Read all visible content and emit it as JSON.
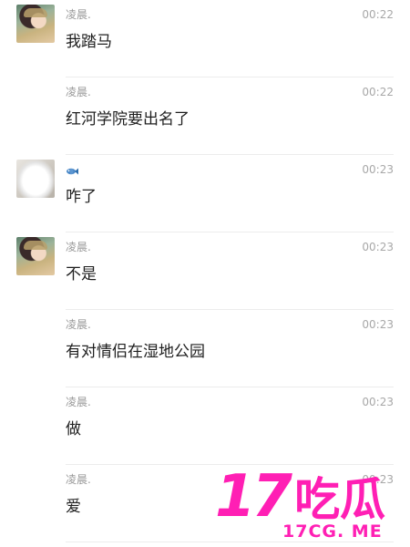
{
  "messages": [
    {
      "name": "凌晨.",
      "time": "00:22",
      "text": "我踏马",
      "avatar": "girl"
    },
    {
      "name": "凌晨.",
      "time": "00:22",
      "text": "红河学院要出名了",
      "avatar": ""
    },
    {
      "name": "",
      "name_icon": "fish-icon",
      "time": "00:23",
      "text": "咋了",
      "avatar": "cloth"
    },
    {
      "name": "凌晨.",
      "time": "00:23",
      "text": "不是",
      "avatar": "girl"
    },
    {
      "name": "凌晨.",
      "time": "00:23",
      "text": "有对情侣在湿地公园",
      "avatar": ""
    },
    {
      "name": "凌晨.",
      "time": "00:23",
      "text": "做",
      "avatar": ""
    },
    {
      "name": "凌晨.",
      "time": "00:23",
      "text": "爱",
      "avatar": ""
    }
  ],
  "watermark": {
    "number": "17",
    "chinese": "吃瓜",
    "url": "17CG. ME",
    "color": "#ff1fb4"
  }
}
